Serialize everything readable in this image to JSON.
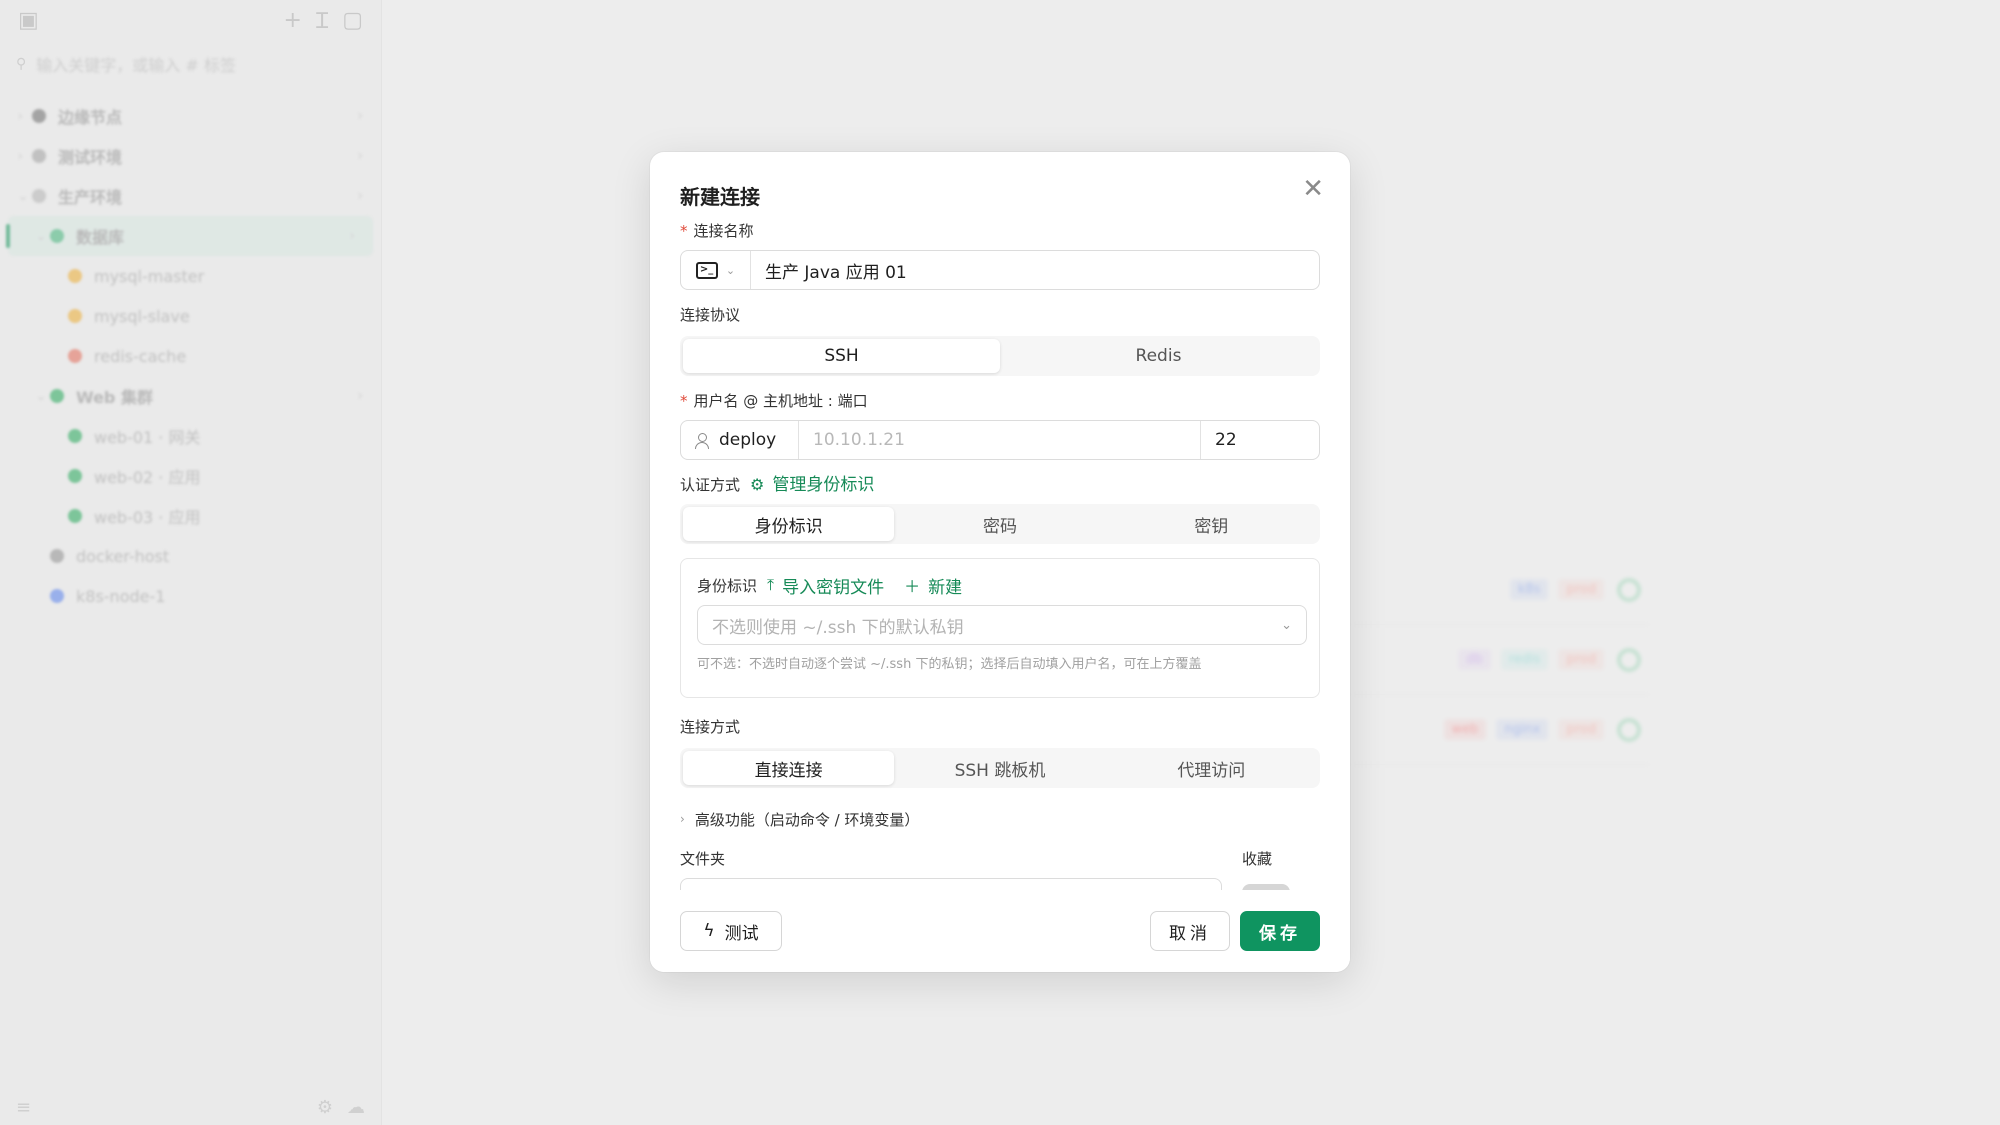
{
  "sidebar": {
    "search_placeholder": "输入关键字，或输入 # 标签",
    "tree": [
      {
        "label": "边缘节点",
        "color": "#7c7c7c",
        "bold": true
      },
      {
        "label": "测试环境",
        "color": "#a8a8a8",
        "bold": true
      },
      {
        "label": "生产环境",
        "color": "#b8b8b8",
        "bold": true
      },
      {
        "label": "数据库",
        "color": "#56b886",
        "bold": true,
        "active": true
      },
      {
        "label": "mysql-master",
        "color": "#e8b24a"
      },
      {
        "label": "mysql-slave",
        "color": "#e8b24a"
      },
      {
        "label": "redis-cache",
        "color": "#e07a6a"
      },
      {
        "label": "Web 集群",
        "color": "#3fae6c",
        "bold": true
      },
      {
        "label": "web-01 · 网关",
        "color": "#3fae6c"
      },
      {
        "label": "web-02 · 应用",
        "color": "#3fae6c"
      },
      {
        "label": "web-03 · 应用",
        "color": "#3fae6c"
      },
      {
        "label": "docker-host",
        "color": "#9a9a9a"
      },
      {
        "label": "k8s-node-1",
        "color": "#6b8ee8"
      }
    ]
  },
  "bg_rows": [
    {
      "tags": [
        {
          "t": "k8s",
          "c": "#8ea6e8"
        },
        {
          "t": "prod",
          "c": "#f0a8a0"
        }
      ]
    },
    {
      "tags": [
        {
          "t": "db",
          "c": "#c7a6e8"
        },
        {
          "t": "redis",
          "c": "#8fd6d2"
        },
        {
          "t": "prod",
          "c": "#f0a8a0"
        }
      ]
    },
    {
      "tags": [
        {
          "t": "web",
          "c": "#f08a8a"
        },
        {
          "t": "nginx",
          "c": "#8ea6e8"
        },
        {
          "t": "prod",
          "c": "#f0a8a0"
        }
      ]
    }
  ],
  "modal": {
    "title": "新建连接",
    "name_label": "连接名称",
    "name_value": "生产 Java 应用 01",
    "protocol_label": "连接协议",
    "protocols": [
      "SSH",
      "Redis"
    ],
    "host_label": "用户名 @ 主机地址 : 端口",
    "user_value": "deploy",
    "host_value": "10.10.1.21",
    "port_value": "22",
    "auth_label": "认证方式",
    "manage_identity": "管理身份标识",
    "auth_options": [
      "身份标识",
      "密码",
      "密钥"
    ],
    "identity_label": "身份标识",
    "import_key": "导入密钥文件",
    "new_label": "新建",
    "identity_placeholder": "不选则使用 ~/.ssh 下的默认私钥",
    "identity_hint": "可不选：不选时自动逐个尝试 ~/.ssh 下的私钥；选择后自动填入用户名，可在上方覆盖",
    "conn_mode_label": "连接方式",
    "conn_modes": [
      "直接连接",
      "SSH 跳板机",
      "代理访问"
    ],
    "advanced_label": "高级功能（启动命令 / 环境变量）",
    "folder_label": "文件夹",
    "favorite_label": "收藏",
    "test_label": "测试",
    "cancel_label": "取消",
    "save_label": "保存"
  },
  "colors": {
    "accent": "#0f9460",
    "required": "#e04a3a"
  }
}
